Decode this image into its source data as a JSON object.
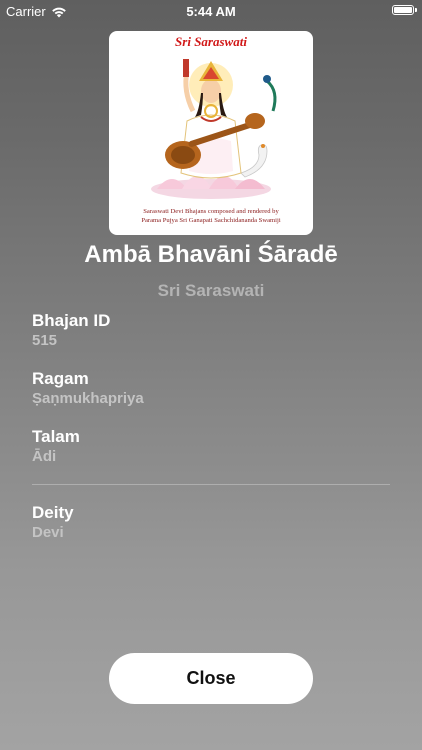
{
  "status_bar": {
    "carrier": "Carrier",
    "time": "5:44 AM"
  },
  "artwork": {
    "title": "Sri Saraswati",
    "caption_line1": "Saraswati Devi Bhajans composed and rendered by",
    "caption_line2": "Parama Pujya Sri Ganapati Sachchidananda Swamiji"
  },
  "song": {
    "title": "Ambā Bhavāni Śāradē",
    "album": "Sri Saraswati"
  },
  "details": {
    "bhajan_id": {
      "label": "Bhajan ID",
      "value": "515"
    },
    "ragam": {
      "label": "Ragam",
      "value": "Ṣaṇmukhapriya"
    },
    "talam": {
      "label": "Talam",
      "value": "Ādi"
    },
    "deity": {
      "label": "Deity",
      "value": "Devi"
    }
  },
  "close_label": "Close",
  "colors": {
    "background_top": "#5f5f5f",
    "background_bottom": "#a3a3a3",
    "secondary_text": "#c4c4c4",
    "artwork_title": "#d11818"
  }
}
